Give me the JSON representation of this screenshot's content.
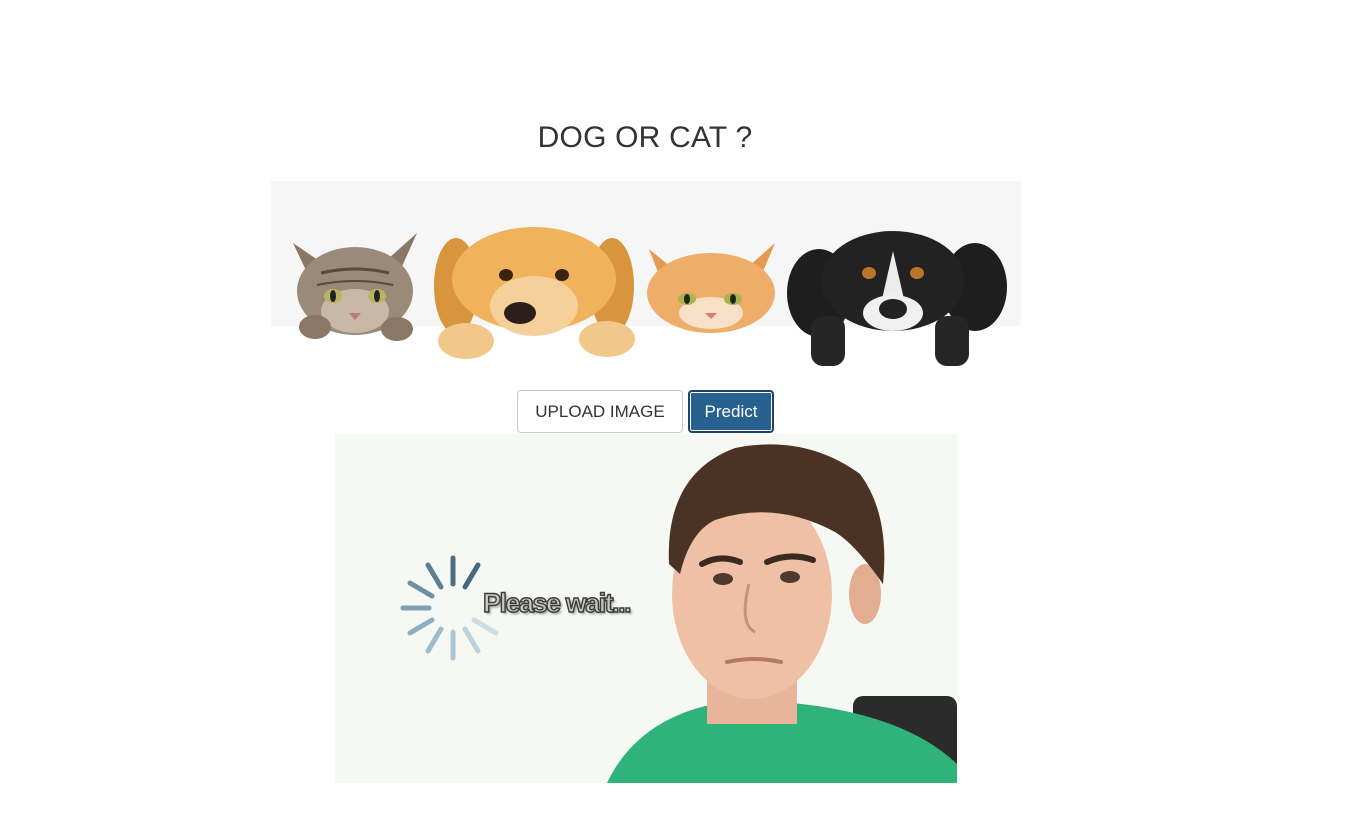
{
  "page": {
    "title": "DOG OR CAT ?"
  },
  "banner": {
    "image_name": "cats-and-dogs-peeking-banner"
  },
  "buttons": {
    "upload_label": "UPLOAD IMAGE",
    "predict_label": "Predict"
  },
  "loading": {
    "image_name": "please-wait-loading-gif",
    "text": "Please wait..."
  },
  "colors": {
    "primary": "#286090",
    "title_text": "#333333",
    "banner_bg": "#f6f6f6"
  }
}
